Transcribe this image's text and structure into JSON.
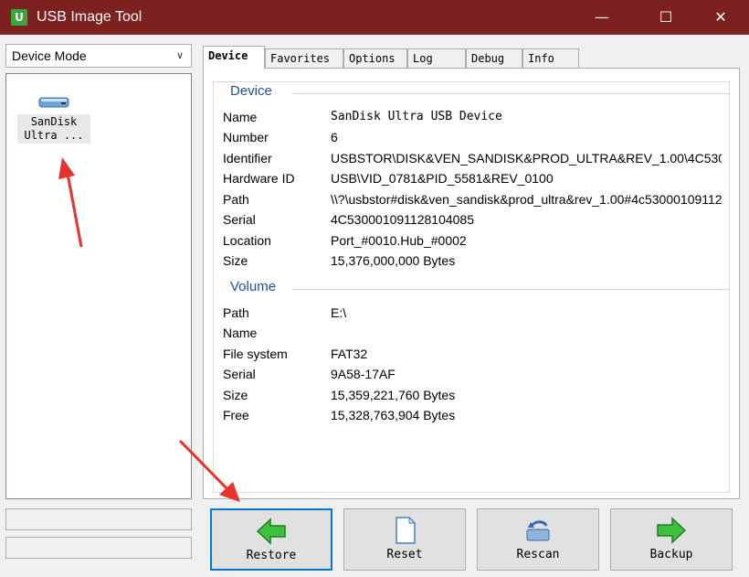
{
  "window": {
    "title": "USB Image Tool",
    "app_icon": "U"
  },
  "titlebar_buttons": {
    "minimize": "—",
    "maximize": "☐",
    "close": "✕"
  },
  "mode_select": {
    "value": "Device Mode"
  },
  "devices": [
    {
      "label_line1": "SanDisk",
      "label_line2": "Ultra ..."
    }
  ],
  "tabs": [
    "Device",
    "Favorites",
    "Options",
    "Log",
    "Debug",
    "Info"
  ],
  "device_section": {
    "header": "Device",
    "rows": [
      {
        "key": "Name",
        "value": "SanDisk Ultra USB Device"
      },
      {
        "key": "Number",
        "value": "6"
      },
      {
        "key": "Identifier",
        "value": "USBSTOR\\DISK&VEN_SANDISK&PROD_ULTRA&REV_1.00\\4C530"
      },
      {
        "key": "Hardware ID",
        "value": "USB\\VID_0781&PID_5581&REV_0100"
      },
      {
        "key": "Path",
        "value": "\\\\?\\usbstor#disk&ven_sandisk&prod_ultra&rev_1.00#4c53000109112"
      },
      {
        "key": "Serial",
        "value": "4C530001091128104085"
      },
      {
        "key": "Location",
        "value": "Port_#0010.Hub_#0002"
      },
      {
        "key": "Size",
        "value": "15,376,000,000 Bytes"
      }
    ]
  },
  "volume_section": {
    "header": "Volume",
    "rows": [
      {
        "key": "Path",
        "value": "E:\\"
      },
      {
        "key": "Name",
        "value": ""
      },
      {
        "key": "File system",
        "value": "FAT32"
      },
      {
        "key": "Serial",
        "value": "9A58-17AF"
      },
      {
        "key": "Size",
        "value": "15,359,221,760 Bytes"
      },
      {
        "key": "Free",
        "value": "15,328,763,904 Bytes"
      }
    ]
  },
  "buttons": {
    "restore": "Restore",
    "reset": "Reset",
    "rescan": "Rescan",
    "backup": "Backup"
  },
  "colors": {
    "titlebar": "#7d2020",
    "section_header": "#1e50a2",
    "annotation_arrow": "#e8322d",
    "focus": "#0078d7"
  }
}
